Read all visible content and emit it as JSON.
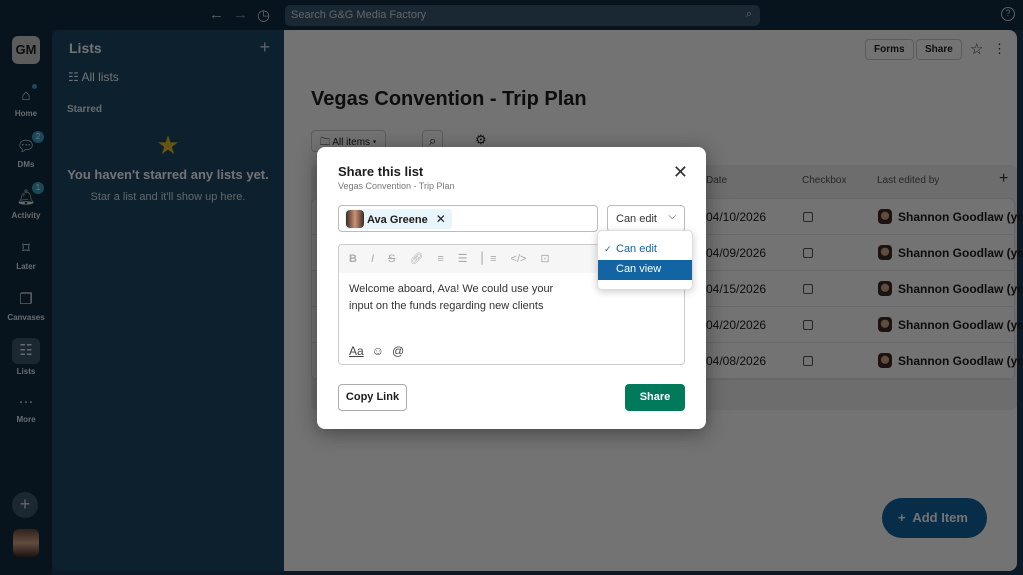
{
  "topbar": {
    "search_placeholder": "Search G&G Media Factory"
  },
  "rail": {
    "workspace": "GM",
    "items": [
      {
        "label": "Home"
      },
      {
        "label": "DMs",
        "badge": "2"
      },
      {
        "label": "Activity",
        "badge": "1"
      },
      {
        "label": "Later"
      },
      {
        "label": "Canvases"
      },
      {
        "label": "Lists"
      },
      {
        "label": "More"
      }
    ]
  },
  "sidebar": {
    "title": "Lists",
    "all_lists": "All lists",
    "starred": "Starred",
    "empty_title": "You haven't starred any lists yet.",
    "empty_sub": "Star a list and it'll show up here."
  },
  "main": {
    "forms": "Forms",
    "share": "Share",
    "title": "Vegas Convention - Trip Plan",
    "filter": "All items",
    "columns": [
      "Date",
      "Checkbox",
      "Last edited by"
    ],
    "rows": [
      {
        "date": "04/10/2026",
        "editor": "Shannon Goodlaw (you)"
      },
      {
        "date": "04/09/2026",
        "editor": "Shannon Goodlaw (you)"
      },
      {
        "date": "04/15/2026",
        "editor": "Shannon Goodlaw (you)"
      },
      {
        "date": "04/20/2026",
        "editor": "Shannon Goodlaw (you)"
      },
      {
        "date": "04/08/2026",
        "editor": "Shannon Goodlaw (you)"
      }
    ],
    "add_item": "Add Item"
  },
  "modal": {
    "title": "Share this list",
    "subtitle": "Vegas Convention - Trip Plan",
    "recipient": "Ava Greene",
    "permission": "Can edit",
    "message": "Welcome aboard, Ava! We could use your input on the funds regarding new clients",
    "copy_link": "Copy Link",
    "share": "Share"
  },
  "dropdown": {
    "options": [
      {
        "label": "Can edit",
        "selected": true
      },
      {
        "label": "Can view",
        "highlighted": true
      }
    ]
  },
  "colors": {
    "share_button": "#007a5a",
    "highlight": "#1264a3",
    "add_item": "#1264a3"
  }
}
